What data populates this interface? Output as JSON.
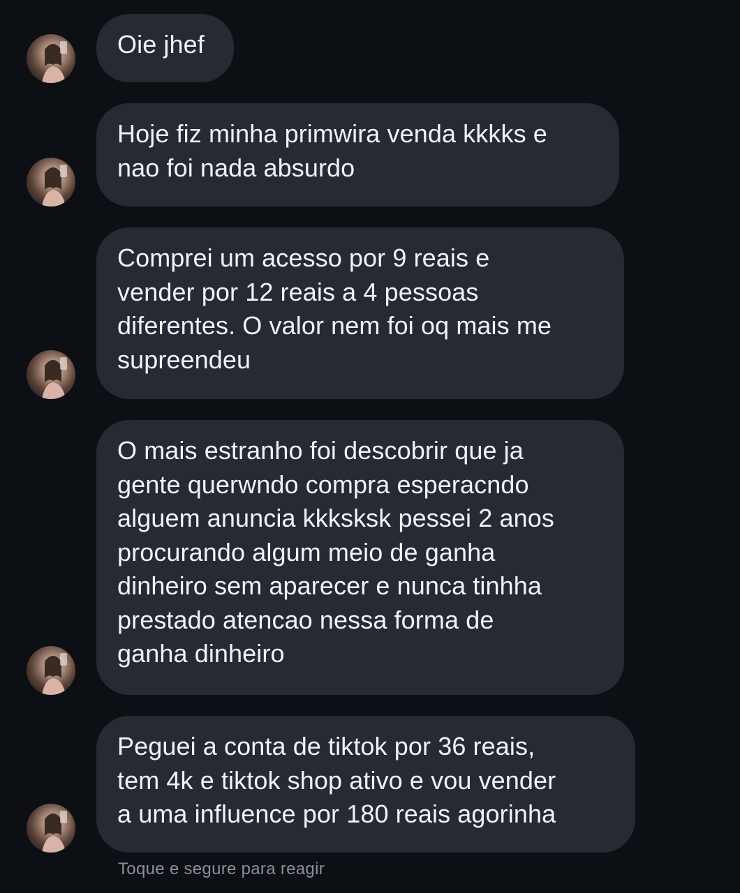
{
  "messages": [
    {
      "text": "Oie jhef"
    },
    {
      "text": "Hoje fiz minha primwira venda kkkks e\nnao foi nada absurdo"
    },
    {
      "text": "Comprei um acesso por 9 reais e\nvender por 12 reais a 4 pessoas\ndiferentes. O valor nem foi oq mais me\nsupreendeu"
    },
    {
      "text": "O mais estranho foi descobrir que ja\ngente querwndo compra esperacndo\nalguem anuncia kkksksk pessei 2 anos\nprocurando algum meio de ganha\ndinheiro sem aparecer e nunca tinhha\nprestado atencao nessa forma de\nganha dinheiro"
    },
    {
      "text": "Peguei a conta de tiktok por 36 reais,\ntem 4k e tiktok shop ativo e vou vender\na uma influence por 180 reais agorinha"
    }
  ],
  "reaction_hint": "Toque e segure para reagir",
  "colors": {
    "background": "#0c0f14",
    "bubble": "#262a33",
    "text": "#f2f3f5",
    "hint": "#8b8f98"
  },
  "icons": {
    "avatar": "sender-avatar-photo"
  }
}
